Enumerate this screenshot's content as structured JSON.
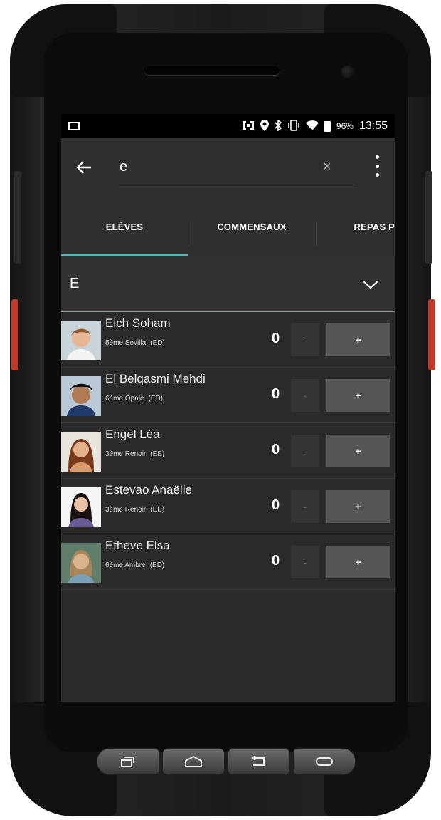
{
  "status_bar": {
    "battery_percent": "96%",
    "time": "13:55",
    "icons": [
      "image-icon",
      "nfc-icon",
      "location-icon",
      "bluetooth-icon",
      "vibrate-icon",
      "wifi-icon",
      "battery-icon"
    ]
  },
  "search": {
    "value": "e",
    "clear_label": "×"
  },
  "tabs": [
    {
      "label": "ELÈVES",
      "selected": true
    },
    {
      "label": "COMMENSAUX",
      "selected": false
    },
    {
      "label": "REPAS P",
      "selected": false
    }
  ],
  "group": {
    "letter": "E"
  },
  "students": [
    {
      "name": "Eich Soham",
      "class": "5ème Sevilla",
      "tag": "(ED)",
      "count": "0",
      "minus": "-",
      "plus": "+"
    },
    {
      "name": "El Belqasmi Mehdi",
      "class": "6ème Opale",
      "tag": "(ED)",
      "count": "0",
      "minus": "-",
      "plus": "+"
    },
    {
      "name": "Engel Léa",
      "class": "3ème Renoir",
      "tag": "(EE)",
      "count": "0",
      "minus": "-",
      "plus": "+"
    },
    {
      "name": "Estevao Anaëlle",
      "class": "3ème Renoir",
      "tag": "(EE)",
      "count": "0",
      "minus": "-",
      "plus": "+"
    },
    {
      "name": "Etheve Elsa",
      "class": "6ème Ambre",
      "tag": "(ED)",
      "count": "0",
      "minus": "-",
      "plus": "+"
    }
  ],
  "colors": {
    "accent": "#5ab4c0",
    "background": "#2a2a2a",
    "toolbar": "#2f2f2f",
    "plus_button": "#555555"
  }
}
